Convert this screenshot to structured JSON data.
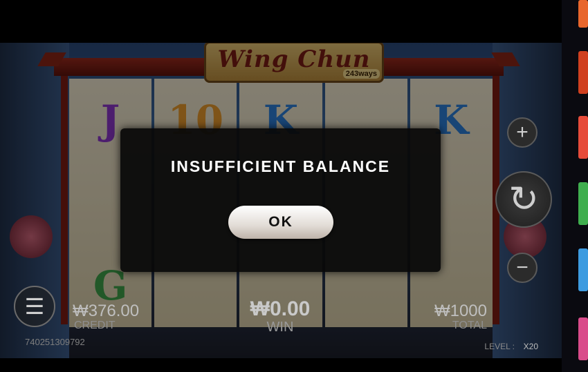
{
  "game": {
    "logo_title": "Wing Chun",
    "logo_badge": "243ways"
  },
  "reels": [
    [
      "J",
      "",
      "G"
    ],
    [
      "10",
      "",
      ""
    ],
    [
      "K",
      "",
      ""
    ],
    [
      "",
      "",
      ""
    ],
    [
      "K",
      "",
      ""
    ]
  ],
  "symbol_colors": {
    "J": "#8b35c9",
    "10": "#e79a2c",
    "K": "#2d7fd8",
    "G": "#3fa04a"
  },
  "controls": {
    "plus_icon": "+",
    "minus_icon": "−",
    "spin_icon": "↻",
    "menu_icon": "☰"
  },
  "stats": {
    "credit_value": "₩376.00",
    "credit_label": "CREDIT",
    "win_value": "₩0.00",
    "win_label": "WIN",
    "total_value": "₩1000",
    "total_label": "TOTAL"
  },
  "session_id": "740251309792",
  "level": {
    "label": "LEVEL :",
    "value": "X20"
  },
  "dialog": {
    "message": "INSUFFICIENT BALANCE",
    "ok_label": "OK"
  },
  "thumb_colors": [
    "#e8662c",
    "#d0401f",
    "#e64b3a",
    "#3fae4e",
    "#3d9be0",
    "#d94b8a"
  ]
}
